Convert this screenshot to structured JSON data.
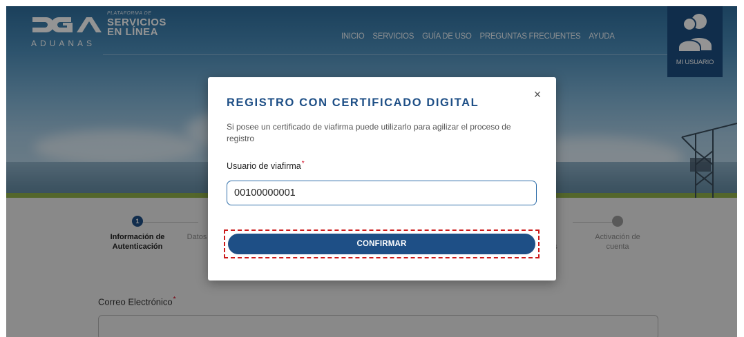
{
  "header": {
    "logo_name": "DGA",
    "logo_subtitle": "ADUANAS",
    "platform_small": "PLATAFORMA DE",
    "platform_line1": "SERVICIOS",
    "platform_line2": "EN LÍNEA",
    "nav": [
      "INICIO",
      "SERVICIOS",
      "GUÍA DE USO",
      "PREGUNTAS FRECUENTES",
      "AYUDA"
    ],
    "user_label": "MI USUARIO"
  },
  "steps": [
    {
      "number": "1",
      "label_line1": "Información de",
      "label_line2": "Autenticación",
      "state": "active"
    },
    {
      "number": "",
      "label_line1": "Datos",
      "label_line2": "",
      "state": "inactive"
    },
    {
      "number": "",
      "label_line1": "",
      "label_line2": "s",
      "state": "inactive"
    },
    {
      "number": "",
      "label_line1": "Activación de",
      "label_line2": "cuenta",
      "state": "inactive"
    }
  ],
  "form": {
    "email_label": "Correo Electrónico",
    "required_mark": "*"
  },
  "modal": {
    "title": "REGISTRO CON CERTIFICADO DIGITAL",
    "description": "Si posee un certificado de viafirma puede utilizarlo para agilizar el proceso de registro",
    "user_label": "Usuario de viafirma",
    "required_mark": "*",
    "user_value": "00100000001",
    "confirm_label": "CONFIRMAR",
    "close_glyph": "×"
  },
  "colors": {
    "primary": "#1e4f86",
    "highlight": "#cc1a1a",
    "required": "#d0021b"
  }
}
